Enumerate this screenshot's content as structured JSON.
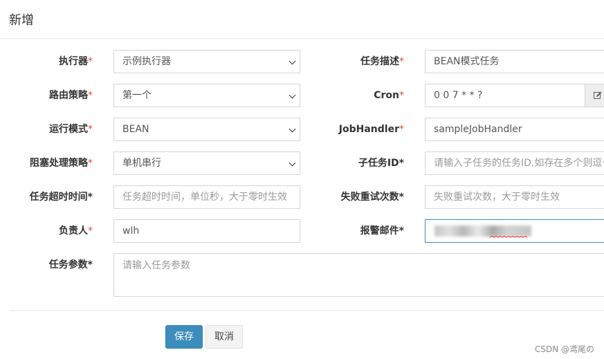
{
  "modal": {
    "title": "新增"
  },
  "form": {
    "executor": {
      "label": "执行器",
      "required": "*",
      "value": "示例执行器"
    },
    "job_desc": {
      "label": "任务描述",
      "required": "*",
      "value": "BEAN模式任务"
    },
    "route_strategy": {
      "label": "路由策略",
      "required": "*",
      "value": "第一个"
    },
    "cron": {
      "label": "Cron",
      "required": "*",
      "value": "0 0 7 * * ?"
    },
    "glue_type": {
      "label": "运行模式",
      "required": "*",
      "value": "BEAN"
    },
    "job_handler": {
      "label": "JobHandler",
      "required": "*",
      "value": "sampleJobHandler"
    },
    "block_strategy": {
      "label": "阻塞处理策略",
      "required": "*",
      "value": "单机串行"
    },
    "child_job_id": {
      "label": "子任务ID",
      "required": "*",
      "placeholder": "请输入子任务的任务ID,如存在多个则逗号分隔"
    },
    "timeout": {
      "label": "任务超时时间",
      "required": "*",
      "placeholder": "任务超时时间，单位秒，大于零时生效"
    },
    "fail_retry": {
      "label": "失败重试次数",
      "required": "*",
      "placeholder": "失败重试次数，大于零时生效"
    },
    "author": {
      "label": "负责人",
      "required": "*",
      "value": "wlh"
    },
    "alarm_email": {
      "label": "报警邮件",
      "required": "*"
    },
    "executor_param": {
      "label": "任务参数",
      "required": "*",
      "placeholder": "请输入任务参数"
    }
  },
  "buttons": {
    "save": "保存",
    "cancel": "取消"
  },
  "watermark": "CSDN @鸢尾の",
  "icons": {
    "cron_addon": "edit-icon",
    "select": "chevron-down-icon"
  },
  "colors": {
    "required": "#dd4b39",
    "primary": "#3c8dbc"
  }
}
